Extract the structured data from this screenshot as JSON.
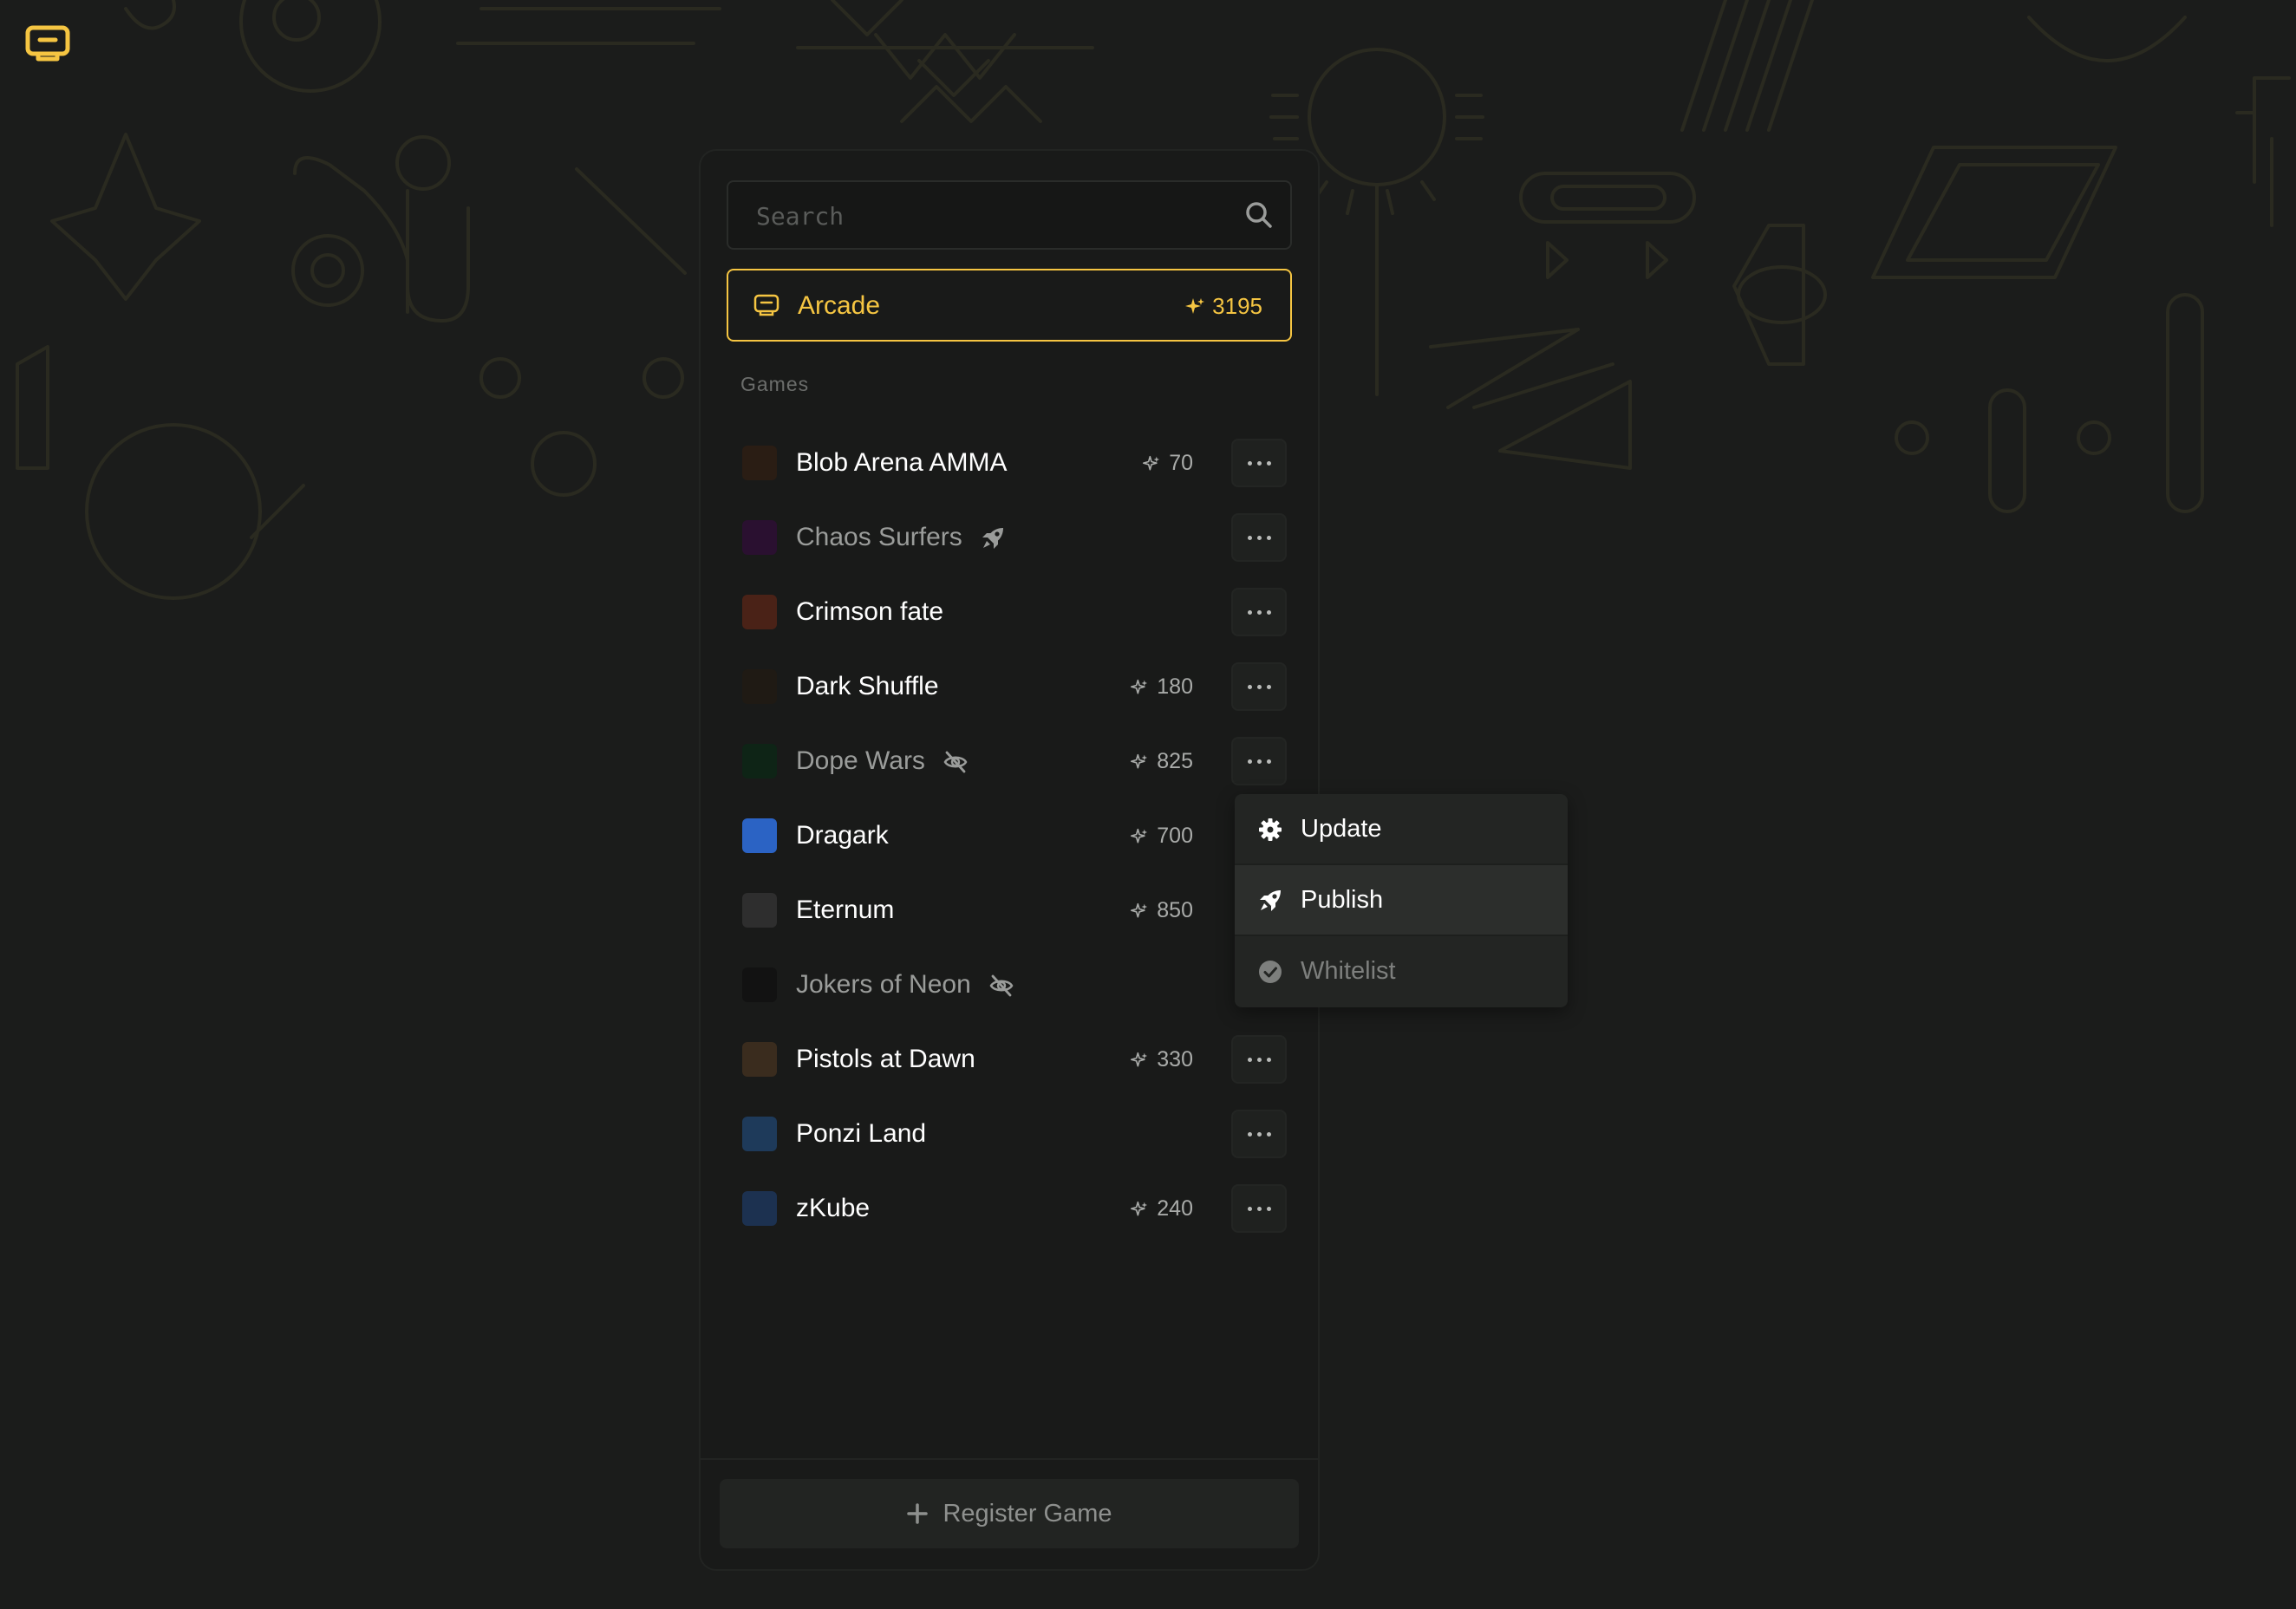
{
  "app": {
    "logo_icon": "controller-icon"
  },
  "search": {
    "placeholder": "Search",
    "value": ""
  },
  "arcade": {
    "label": "Arcade",
    "points": "3195",
    "icon": "controller-icon",
    "accent": "#f5c542"
  },
  "games_section": {
    "label": "Games"
  },
  "games": [
    {
      "name": "Blob Arena AMMA",
      "points": "70",
      "status": "",
      "dim": false,
      "thumb_color": "#2a1d14"
    },
    {
      "name": "Chaos Surfers",
      "points": "",
      "status": "rocket-icon",
      "dim": true,
      "thumb_color": "#2a1030"
    },
    {
      "name": "Crimson fate",
      "points": "",
      "status": "",
      "dim": false,
      "thumb_color": "#4a2217"
    },
    {
      "name": "Dark Shuffle",
      "points": "180",
      "status": "",
      "dim": false,
      "thumb_color": "#1f1a14"
    },
    {
      "name": "Dope Wars",
      "points": "825",
      "status": "eye-off-icon",
      "dim": true,
      "thumb_color": "#0e2416"
    },
    {
      "name": "Dragark",
      "points": "700",
      "status": "",
      "dim": false,
      "thumb_color": "#2b63c4"
    },
    {
      "name": "Eternum",
      "points": "850",
      "status": "",
      "dim": false,
      "thumb_color": "#2e2e2e"
    },
    {
      "name": "Jokers of Neon",
      "points": "",
      "status": "eye-off-icon",
      "dim": true,
      "thumb_color": "#121212"
    },
    {
      "name": "Pistols at Dawn",
      "points": "330",
      "status": "",
      "dim": false,
      "thumb_color": "#3a2c1e"
    },
    {
      "name": "Ponzi Land",
      "points": "",
      "status": "",
      "dim": false,
      "thumb_color": "#1e3a5a"
    },
    {
      "name": "zKube",
      "points": "240",
      "status": "",
      "dim": false,
      "thumb_color": "#1c3150"
    }
  ],
  "context_menu": {
    "items": [
      {
        "label": "Update",
        "icon": "gear-icon",
        "state": "normal"
      },
      {
        "label": "Publish",
        "icon": "rocket-icon",
        "state": "hover"
      },
      {
        "label": "Whitelist",
        "icon": "check-circle-icon",
        "state": "disabled"
      }
    ]
  },
  "register": {
    "label": "Register Game",
    "icon": "plus-icon"
  }
}
